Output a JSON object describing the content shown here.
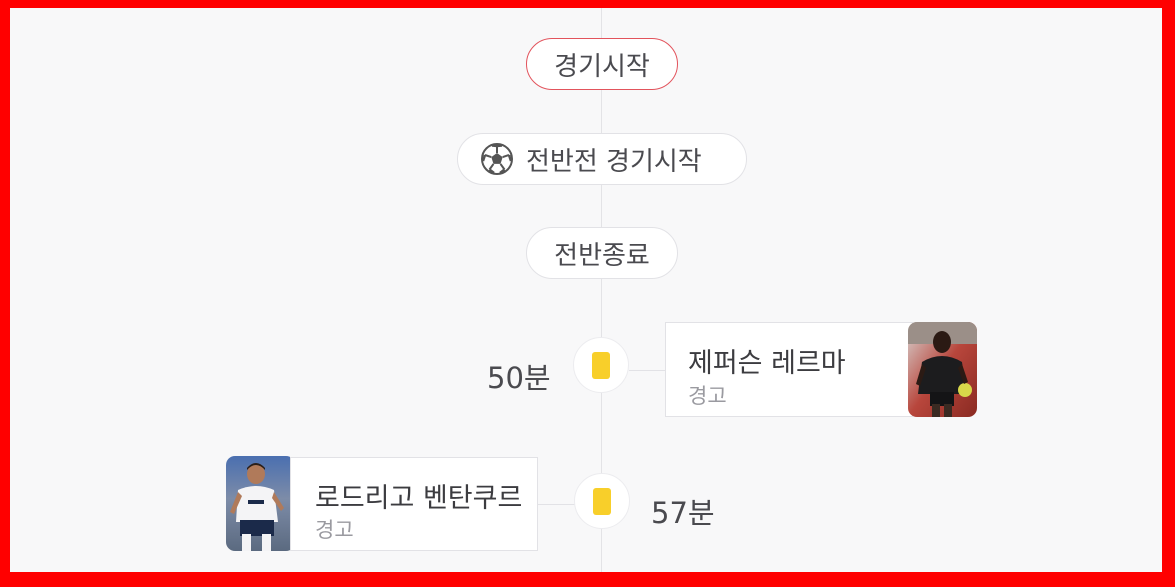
{
  "timeline": {
    "match_start_label": "경기시작",
    "first_half_start_label": "전반전 경기시작",
    "first_half_end_label": "전반종료",
    "events": [
      {
        "minute": "50분",
        "player": "제퍼슨 레르마",
        "type": "경고",
        "card": "yellow-card"
      },
      {
        "minute": "57분",
        "player": "로드리고 벤탄쿠르",
        "type": "경고",
        "card": "yellow-card"
      }
    ]
  },
  "colors": {
    "background": "#f8f8f9",
    "start_pill_border": "#e2535c",
    "yellow_card": "#f8cf2a",
    "frame": "#ff0000"
  }
}
